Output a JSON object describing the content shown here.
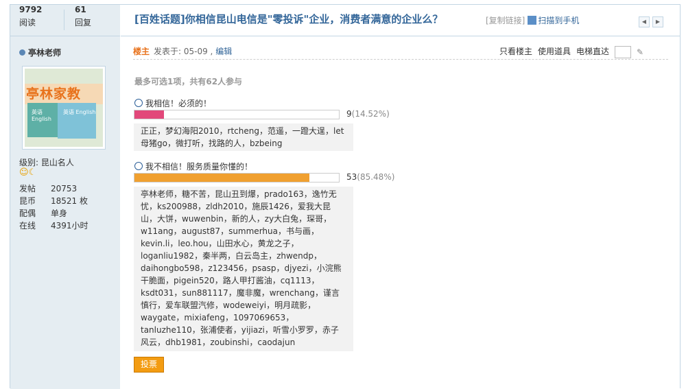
{
  "stats": {
    "views_num": "9792",
    "views_label": "阅读",
    "replies_num": "61",
    "replies_label": "回复"
  },
  "header": {
    "title": "[百姓话题]你相信昆山电信是\"零投诉\"企业，消费者满意的企业么？",
    "copy_link": "[复制链接]",
    "scan": "扫描到手机"
  },
  "author": {
    "name": "亭林老师",
    "avatar_text": "亭林家教",
    "avatar_book_label": "英语 English",
    "level_label": "级别: 昆山名人",
    "faces": "☺☾",
    "fields": [
      {
        "k": "发帖",
        "v": "20753"
      },
      {
        "k": "昆币",
        "v": "18521 枚"
      },
      {
        "k": "配偶",
        "v": "单身"
      },
      {
        "k": "在线",
        "v": "4391小时"
      }
    ]
  },
  "post": {
    "louzhu": "楼主",
    "posted": "发表于: 05-09 ,",
    "edit": "编辑",
    "only_author": "只看楼主",
    "use_tool": "使用道具",
    "elevator": "电梯直达"
  },
  "poll": {
    "info": "最多可选1项，共有62人参与",
    "accent_pink": "#e2487a",
    "accent_orange": "#f0a030",
    "options": [
      {
        "label": "我相信！必须的！",
        "count": "9",
        "percent_text": "(14.52%)",
        "percent": 14.52,
        "voters": "正正，梦幻海阳2010，rtcheng，范遥，一蹬大逞，let母猪go，微打听，找路的人，bzbeing"
      },
      {
        "label": "我不相信！服务质量你懂的！",
        "count": "53",
        "percent_text": "(85.48%)",
        "percent": 85.48,
        "voters": "亭林老师，糖不苦，昆山丑到爆，prado163，逸竹无忧，ks200988，zldh2010，施辰1426，爱我大昆山，大饼，wuwenbin，新的人，zy大白兔，琛哥，w11ang，august87，summerhua，书与画，kevin.li，leo.hou，山田水心，黄龙之子，loganliu1982，秦半两，白云岛主，zhwendp，daihongbo598，z123456，psasp，djyezi，小浣熊干脆面，pigein520，路人甲打酱油，cq1113，ksdt031，sun881117，魔非魔，wrenchang，谨言慎行，爱车联盟汽修，wodeweiyi，明月疏影，waygate，mixiafeng，1097069653，tanluzhe110，张浦使者，yijiazi，听雪小罗罗，赤子风云，dhb1981，zoubinshi，caodajun"
      }
    ],
    "vote_button": "投票"
  }
}
